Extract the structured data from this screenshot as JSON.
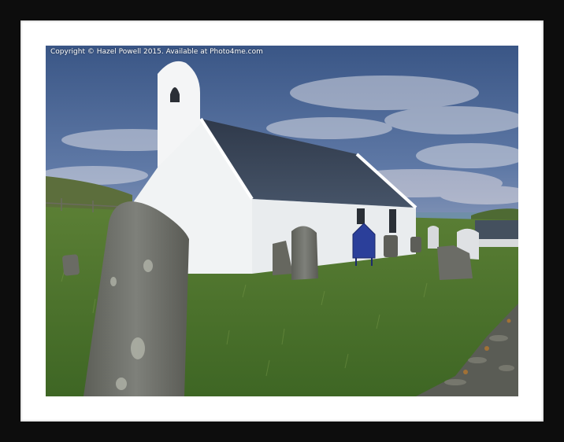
{
  "watermark": {
    "text": "Copyright © Hazel Powell 2015. Available at Photo4me.com"
  },
  "scene": {
    "subject": "white-church-with-bellcote-and-graveyard",
    "colors": {
      "frame": "#0d0d0d",
      "mat": "#ffffff",
      "sky_top": "#3f5f8e",
      "sky_bottom": "#c9c6d2",
      "church_wall": "#eef0f2",
      "roof": "#3a4658",
      "grass": "#4f7a2c",
      "headstone": "#6f6f68",
      "sign": "#2b3f9a"
    }
  }
}
